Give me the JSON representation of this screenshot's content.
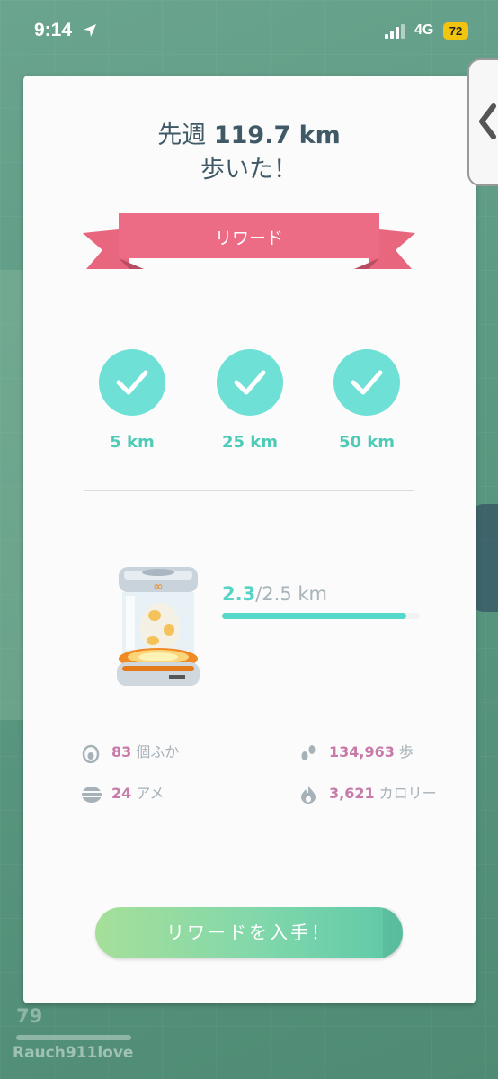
{
  "status_bar": {
    "time": "9:14",
    "network": "4G",
    "battery": "72"
  },
  "header": {
    "prefix": "先週",
    "distance": "119.7 km",
    "suffix": "歩いた！"
  },
  "ribbon": {
    "label": "リワード"
  },
  "milestones": [
    {
      "label": "5 km",
      "completed": true
    },
    {
      "label": "25 km",
      "completed": true
    },
    {
      "label": "50 km",
      "completed": true
    }
  ],
  "incubator": {
    "current": "2.3",
    "target": "/2.5 km",
    "progress": 0.93
  },
  "stats": {
    "hatched": {
      "value": "83",
      "label": "個ふか"
    },
    "steps": {
      "value": "134,963",
      "label": "歩"
    },
    "candy": {
      "value": "24",
      "label": "アメ"
    },
    "calories": {
      "value": "3,621",
      "label": "カロリー"
    }
  },
  "cta": {
    "label": "リワードを入手！"
  },
  "player": {
    "level": "79",
    "username": "Rauch911love"
  },
  "colors": {
    "ribbon": "#e8667e",
    "milestone": "#6ee0d6",
    "accent": "#4ecbb6",
    "stat_number": "#c87aa8"
  }
}
